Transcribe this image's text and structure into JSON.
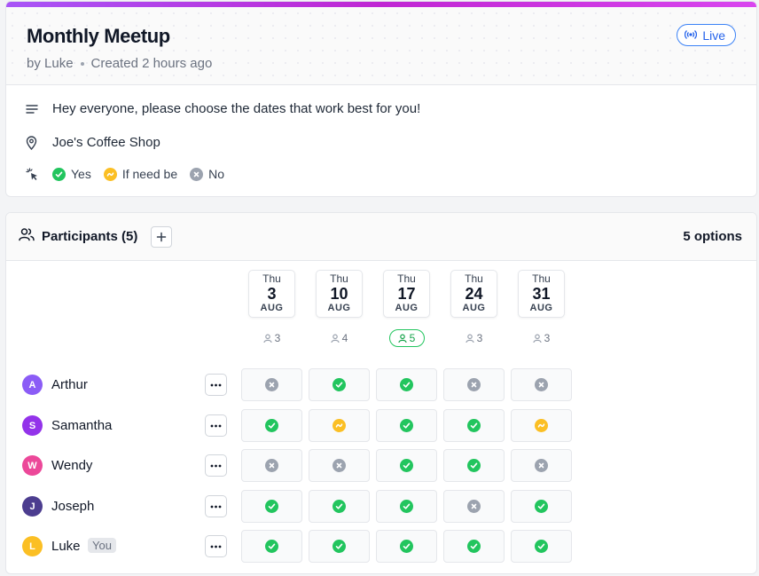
{
  "event": {
    "title": "Monthly Meetup",
    "author": "by Luke",
    "created": "Created 2 hours ago",
    "live_label": "Live",
    "description": "Hey everyone, please choose the dates that work best for you!",
    "location": "Joe's Coffee Shop",
    "legend": {
      "yes": "Yes",
      "maybe": "If need be",
      "no": "No"
    }
  },
  "poll": {
    "title": "Participants (5)",
    "options_count": "5 options",
    "options": [
      {
        "dow": "Thu",
        "day": "3",
        "month": "AUG",
        "count": "3",
        "best": false
      },
      {
        "dow": "Thu",
        "day": "10",
        "month": "AUG",
        "count": "4",
        "best": false
      },
      {
        "dow": "Thu",
        "day": "17",
        "month": "AUG",
        "count": "5",
        "best": true
      },
      {
        "dow": "Thu",
        "day": "24",
        "month": "AUG",
        "count": "3",
        "best": false
      },
      {
        "dow": "Thu",
        "day": "31",
        "month": "AUG",
        "count": "3",
        "best": false
      }
    ],
    "participants": [
      {
        "initial": "A",
        "name": "Arthur",
        "color": "#8b5cf6",
        "you": "",
        "votes": [
          "no",
          "yes",
          "yes",
          "no",
          "no"
        ]
      },
      {
        "initial": "S",
        "name": "Samantha",
        "color": "#9333ea",
        "you": "",
        "votes": [
          "yes",
          "maybe",
          "yes",
          "yes",
          "maybe"
        ]
      },
      {
        "initial": "W",
        "name": "Wendy",
        "color": "#ec4899",
        "you": "",
        "votes": [
          "no",
          "no",
          "yes",
          "yes",
          "no"
        ]
      },
      {
        "initial": "J",
        "name": "Joseph",
        "color": "#4c3d8f",
        "you": "",
        "votes": [
          "yes",
          "yes",
          "yes",
          "no",
          "yes"
        ]
      },
      {
        "initial": "L",
        "name": "Luke",
        "color": "#fbbf24",
        "you": "You",
        "votes": [
          "yes",
          "yes",
          "yes",
          "yes",
          "yes"
        ]
      }
    ]
  },
  "colors": {
    "yes": "#22c55e",
    "maybe": "#fbbf24",
    "no": "#9ca3af",
    "accent": "#2563eb"
  },
  "icons": {
    "description": "text-lines-icon",
    "location": "map-pin-icon",
    "legend": "pointer-click-icon",
    "live": "broadcast-icon",
    "participants": "users-icon",
    "add": "plus-icon",
    "more": "ellipsis-icon",
    "count": "user-icon"
  }
}
